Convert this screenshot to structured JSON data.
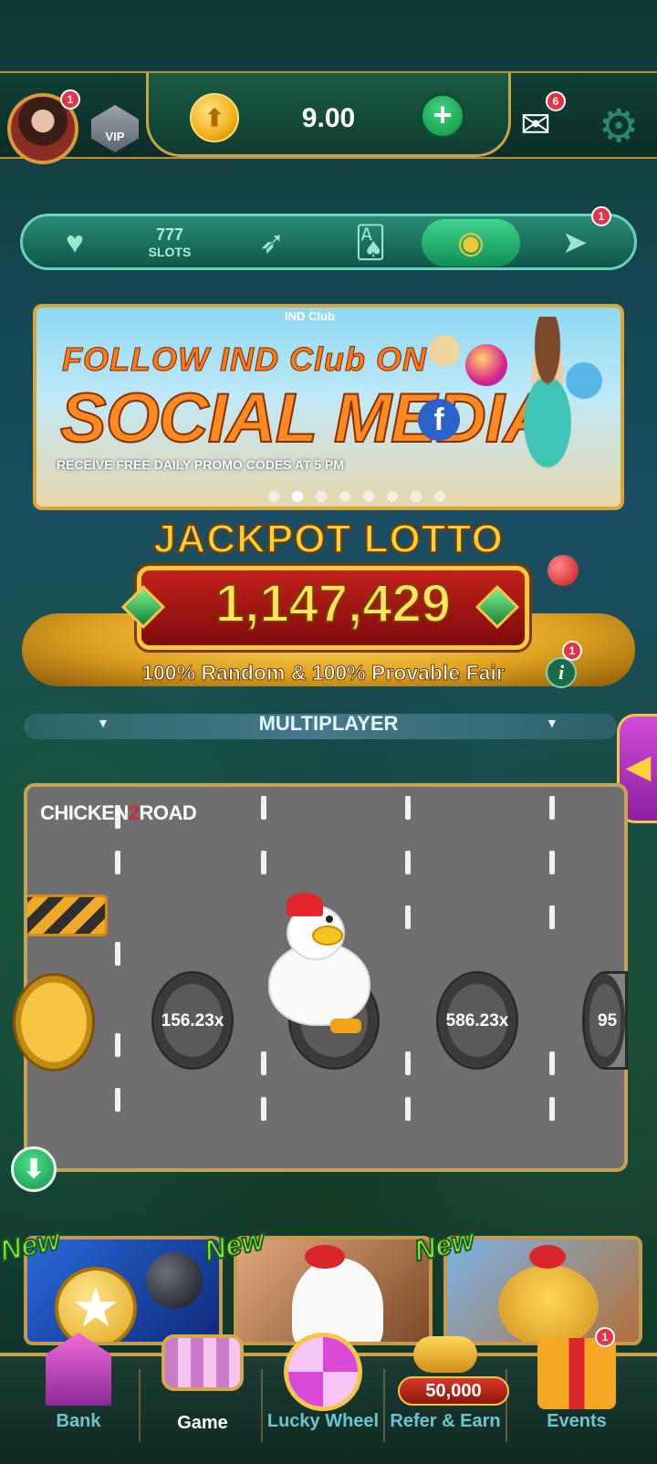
{
  "header": {
    "profile_badge": "1",
    "vip_label": "VIP",
    "balance": "9.00",
    "add_label": "+",
    "mail_badge": "6"
  },
  "categories": {
    "items": [
      {
        "name": "favorites",
        "icon": "heart-icon"
      },
      {
        "name": "slots",
        "label": "SLOTS",
        "icon": "777-icon"
      },
      {
        "name": "crash",
        "icon": "rocket-icon"
      },
      {
        "name": "cards",
        "icon": "cards-icon"
      },
      {
        "name": "roulette",
        "icon": "roulette-icon",
        "active": true
      },
      {
        "name": "fishing",
        "icon": "shark-icon",
        "badge": "1"
      }
    ]
  },
  "banner": {
    "logo": "IND Club",
    "title_line1": "FOLLOW IND Club ON",
    "title_line2": "SOCIAL MEDIA",
    "subtitle": "RECEIVE FREE DAILY PROMO CODES AT 5 PM",
    "dot_count": 8,
    "active_dot": 1
  },
  "jackpot": {
    "title": "JACKPOT LOTTO",
    "amount": "1,147,429",
    "fair_text": "100% Random & 100% Provable Fair",
    "info_label": "i",
    "info_badge": "1"
  },
  "multiplayer": {
    "label": "MULTIPLAYER"
  },
  "game": {
    "logo_part1": "CHICKEN",
    "logo_part2": "2",
    "logo_part3": "ROAD",
    "multipliers": [
      "156.23x",
      "586.23x",
      "95"
    ],
    "hidden_multiplier": "x"
  },
  "new_games": {
    "tag": "New",
    "count": 3
  },
  "bottom_nav": {
    "bank": "Bank",
    "game": "Game",
    "lucky_wheel": "Lucky Wheel",
    "refer": "Refer & Earn",
    "refer_amount": "50,000",
    "events": "Events",
    "events_badge": "1"
  },
  "colors": {
    "gold": "#c9a24a",
    "accent_green": "#149650",
    "badge_red": "#e2334a",
    "nav_label": "#6ec5d0"
  }
}
